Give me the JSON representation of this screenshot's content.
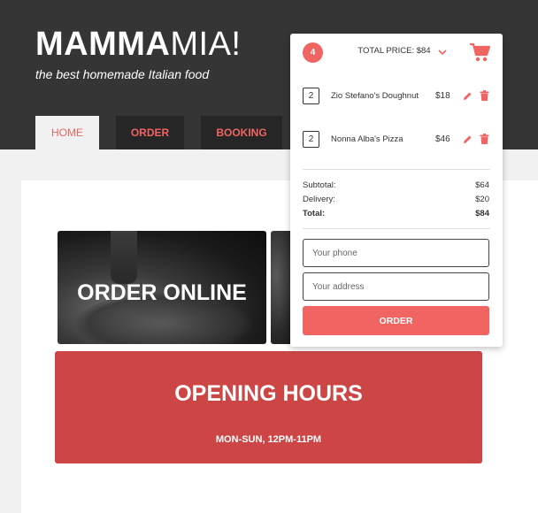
{
  "header": {
    "logo_bold": "MAMMA",
    "logo_thin": "MIA!",
    "tagline": "the best homemade Italian food"
  },
  "nav": {
    "tabs": [
      {
        "label": "HOME",
        "active": true
      },
      {
        "label": "ORDER",
        "active": false
      },
      {
        "label": "BOOKING",
        "active": false
      }
    ]
  },
  "cart": {
    "count": "4",
    "total_label": "TOTAL PRICE: $84",
    "items": [
      {
        "qty": "2",
        "name": "Zio Stefano's Doughnut",
        "price": "$18"
      },
      {
        "qty": "2",
        "name": "Nonna Alba's Pizza",
        "price": "$46"
      }
    ],
    "summary": {
      "subtotal_label": "Subtotal:",
      "subtotal": "$64",
      "delivery_label": "Delivery:",
      "delivery": "$20",
      "total_label": "Total:",
      "total": "$84"
    },
    "phone_placeholder": "Your phone",
    "address_placeholder": "Your address",
    "order_label": "ORDER"
  },
  "main": {
    "promo_title": "ORDER ONLINE",
    "hours_title": "OPENING HOURS",
    "hours_text": "MON-SUN, 12PM-11PM"
  },
  "colors": {
    "accent": "#f06462",
    "header_bg": "#353535",
    "hours_bg": "#cc4646"
  },
  "icons": [
    "chevron-down-icon",
    "cart-icon",
    "edit-icon",
    "trash-icon"
  ]
}
